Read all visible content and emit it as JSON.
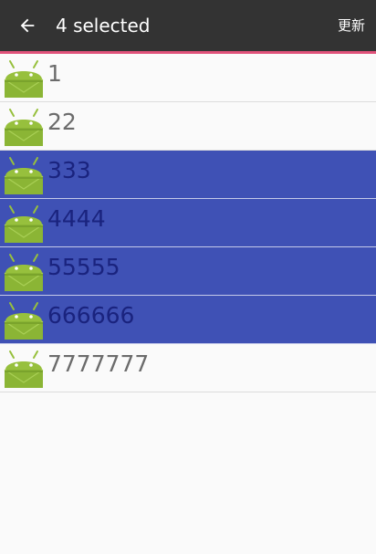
{
  "actionbar": {
    "title": "4 selected",
    "update_label": "更新",
    "back_icon": "arrow-back-icon"
  },
  "colors": {
    "actionbar": "#333333",
    "accent": "#e0527a",
    "selected_row": "#3f51b5",
    "android_green": "#97c03d"
  },
  "list": {
    "items": [
      {
        "label": "1",
        "selected": false,
        "icon": "android-icon"
      },
      {
        "label": "22",
        "selected": false,
        "icon": "android-icon"
      },
      {
        "label": "333",
        "selected": true,
        "icon": "android-icon"
      },
      {
        "label": "4444",
        "selected": true,
        "icon": "android-icon"
      },
      {
        "label": "55555",
        "selected": true,
        "icon": "android-icon"
      },
      {
        "label": "666666",
        "selected": true,
        "icon": "android-icon"
      },
      {
        "label": "7777777",
        "selected": false,
        "icon": "android-icon"
      }
    ]
  }
}
